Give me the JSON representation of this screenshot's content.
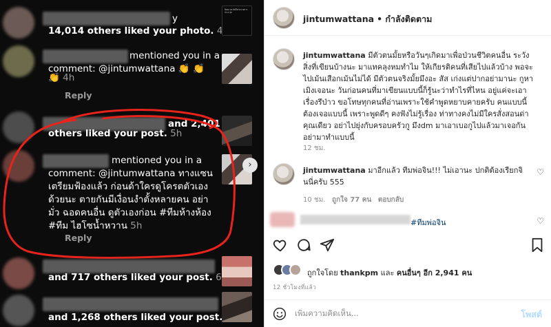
{
  "activity": {
    "item1": {
      "count_text": "14,014 others liked your photo.",
      "time": "4h"
    },
    "item2": {
      "mention_text": "mentioned you in a",
      "comment_text": "comment: @jintumwattana",
      "emoji": "👏 👏 👏",
      "time": "4h",
      "reply": "Reply"
    },
    "item3": {
      "count_a": "and 2,401",
      "count_b": "others liked your post.",
      "time": "5h"
    },
    "item4": {
      "mention_text": "mentioned you in a",
      "comment_text": "comment: @jintumwattana ทางแซน เตรียมฟ้องแล้ว ก่อนด้าใครดูโครตตัวเอง ด้วยนะ ตายกันมีเงื่อนงำตั้งหลายคน อย่ามั่ว ฉอดคนอื่น ดูตัวเองก่อน #ทีมห้างห้อง #ทีม ไฮโซน้ำหวาน",
      "time": "5h",
      "reply": "Reply"
    },
    "item5": {
      "count_text": "and 717 others liked your post.",
      "time": "6h"
    },
    "item6": {
      "count_text": "and 1,268 others liked your post.",
      "time": "6h"
    },
    "thumb1_text": "ปิดตะวด่ายิงก็ตามรายการประกาศ"
  },
  "post": {
    "username": "jintumwattana",
    "follow_label": "• กำลังติดตาม",
    "caption_user": "jintumwattana",
    "caption": "มีตัวตนมั้ยหรือวันๆเกิดมาเพื่อป่วนชีวิตคนอื่น ระวังสิ่งที่เขียนบ้างนะ มาแทคลุงหมทำไม ให้เกียรติคนที่เสียไปแล้วบ้าง พอจะไปเม้นเสือกเม้นไม่ได้ มีตัวตนจริงมั้ยมึงอะ สัส เก่งแต่ปากอย่ามานะ กูหาเมิงเจอนะ วันก่อนคนที่มาเขียนแบบนี้ก็รู้นะว่าทำไรที่ไหน อยู่แค่จะเอาเรื่องรึป่าว ขอโทษทุกคนที่อ่านเพราะใช้คำพูดหยาบคายครับ คนแบบนี้ต้องเจอแบบนี้ เพราะพูดดีๆ คงฟังไม่รู้เรื่อง ท่าทางคงไม่มีใครสั่งสอนด่าคุณเดียว อย่าไปยุ่งกับครอบครัวกู มึงdm มาเอาเบอกูไปแล้วมาเจอกัน อย่ามาทำแบบนี้",
    "caption_time": "12 ชม.",
    "reply_user": "jintumwattana",
    "reply_text": "มาอีกแล้ว ทีมพ่อจิน!!! ไม่เอานะ ปกติต้องเรียกจินนี่ครับ 555",
    "reply_time": "10 ชม.",
    "reply_likes": "ถูกใจ 77 คน",
    "reply_action": "ตอบกลับ",
    "third_tag": "#ทีมพ่อจิน",
    "liked_by_prefix": "ถูกใจโดย",
    "liked_by_user": "thankpm",
    "liked_by_and": "และ",
    "liked_by_others": "คนอื่นๆ อีก 2,941 คน",
    "posted_ago": "12 ชั่วโมงที่แล้ว",
    "comment_placeholder": "เพิ่มความคิดเห็น...",
    "post_button": "โพสต์"
  },
  "colors": {
    "accent": "#0095f6",
    "red_circle": "#e8231b",
    "panel_dark": "#0c0c0c"
  }
}
